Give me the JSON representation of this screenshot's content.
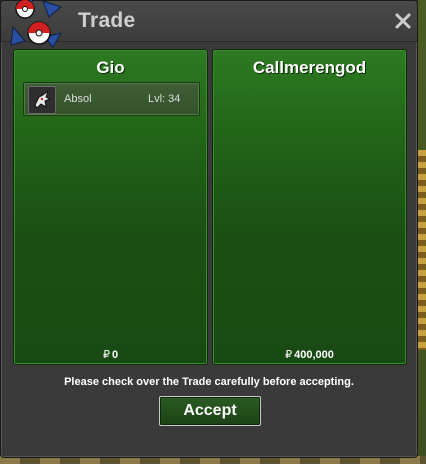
{
  "window": {
    "title": "Trade",
    "close_icon": "close-x-icon",
    "logo_icon": "pokeball-logo-icon"
  },
  "left_panel": {
    "player_name": "Gio",
    "items": [
      {
        "icon": "absol-sprite-icon",
        "name": "Absol",
        "level": "Lvl: 34"
      }
    ],
    "currency_symbol": "₽",
    "money": "0"
  },
  "right_panel": {
    "player_name": "Callmerengod",
    "items": [],
    "currency_symbol": "₽",
    "money": "400,000"
  },
  "footer": {
    "notice": "Please check over the Trade carefully before accepting.",
    "accept_label": "Accept"
  },
  "colors": {
    "panel_green": "#226618",
    "window_bg": "#3a3a3a",
    "title_text": "#cfcfcf"
  }
}
